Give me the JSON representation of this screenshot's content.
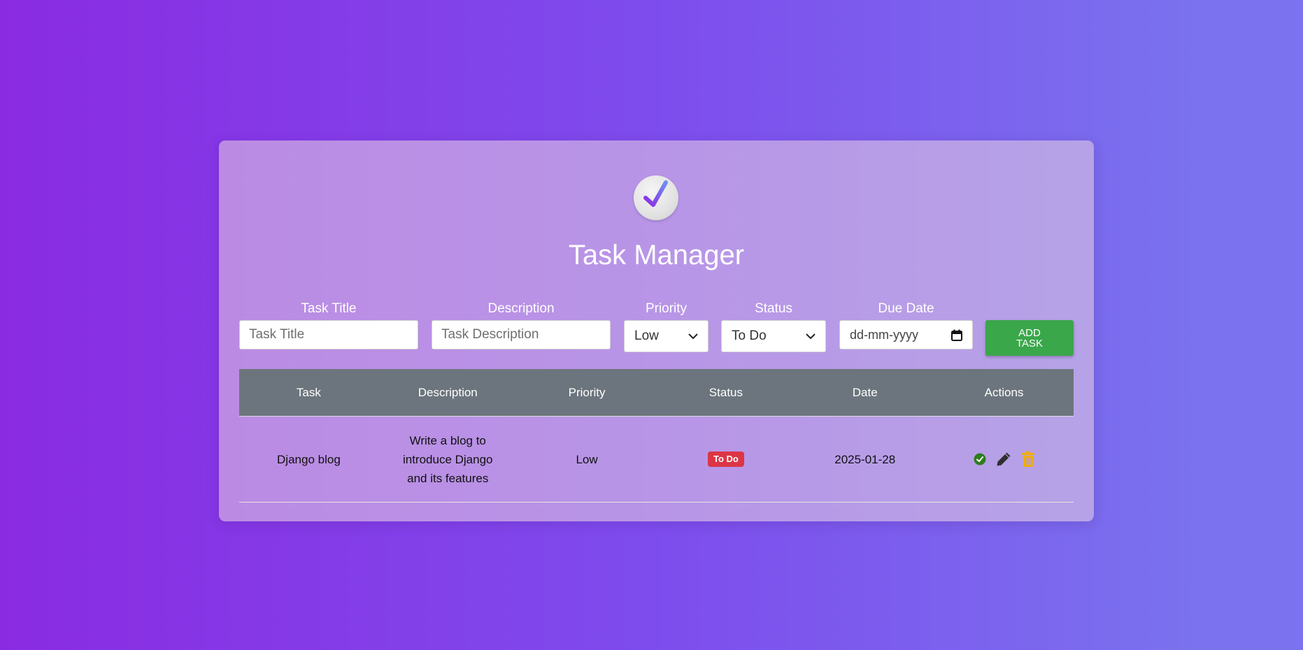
{
  "app": {
    "title": "Task Manager",
    "logo_icon": "check-circle-icon",
    "accent_color": "#7b3fe4"
  },
  "form": {
    "title_label": "Task Title",
    "title_placeholder": "Task Title",
    "description_label": "Description",
    "description_placeholder": "Task Description",
    "priority_label": "Priority",
    "priority_value": "Low",
    "status_label": "Status",
    "status_value": "To Do",
    "due_date_label": "Due Date",
    "due_date_placeholder": "dd-mm-yyyy",
    "add_button_label": "ADD\nTASK",
    "add_button_color": "#3aa74a"
  },
  "table": {
    "headers": [
      "Task",
      "Description",
      "Priority",
      "Status",
      "Date",
      "Actions"
    ],
    "rows": [
      {
        "task": "Django blog",
        "description": "Write a blog to introduce Django and its features",
        "priority": "Low",
        "status": "To Do",
        "status_color": "#dc3545",
        "date": "2025-01-28",
        "actions": [
          "complete-icon",
          "edit-pencil-icon",
          "delete-trash-icon"
        ]
      }
    ]
  }
}
